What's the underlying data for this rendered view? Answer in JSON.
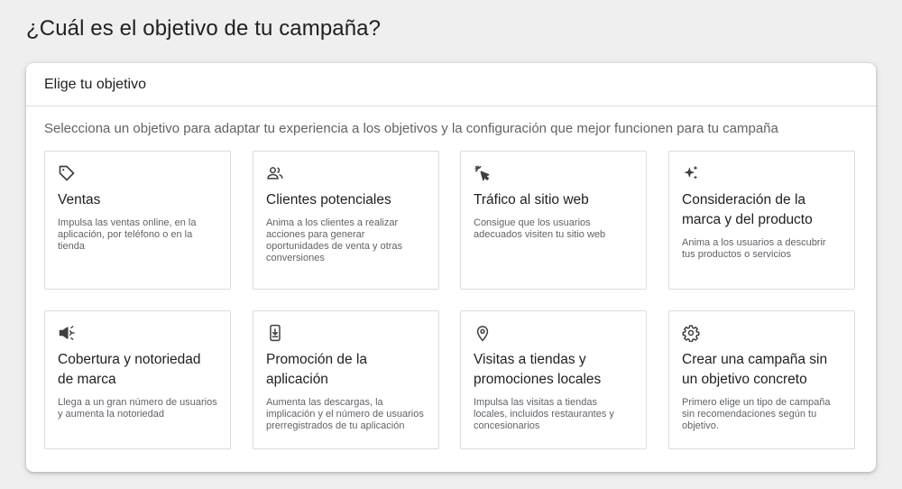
{
  "page": {
    "title": "¿Cuál es el objetivo de tu campaña?"
  },
  "panel": {
    "header": "Elige tu objetivo",
    "description": "Selecciona un objetivo para adaptar tu experiencia a los objetivos y la configuración que mejor funcionen para tu campaña"
  },
  "objectives": [
    {
      "icon": "tag-icon",
      "title": "Ventas",
      "description": "Impulsa las ventas online, en la aplicación, por teléfono o en la tienda"
    },
    {
      "icon": "people-icon",
      "title": "Clientes potenciales",
      "description": "Anima a los clientes a realizar acciones para generar oportunidades de venta y otras conversiones"
    },
    {
      "icon": "cursor-click-icon",
      "title": "Tráfico al sitio web",
      "description": "Consigue que los usuarios adecuados visiten tu sitio web"
    },
    {
      "icon": "sparkle-icon",
      "title": "Consideración de la marca y del producto",
      "description": "Anima a los usuarios a descubrir tus productos o servicios"
    },
    {
      "icon": "megaphone-icon",
      "title": "Cobertura y notoriedad de marca",
      "description": "Llega a un gran número de usuarios y aumenta la notoriedad"
    },
    {
      "icon": "phone-download-icon",
      "title": "Promoción de la aplicación",
      "description": "Aumenta las descargas, la implicación y el número de usuarios prerregistrados de tu aplicación"
    },
    {
      "icon": "location-pin-icon",
      "title": "Visitas a tiendas y promociones locales",
      "description": "Impulsa las visitas a tiendas locales, incluidos restaurantes y concesionarios"
    },
    {
      "icon": "gear-icon",
      "title": "Crear una campaña sin un objetivo concreto",
      "description": "Primero elige un tipo de campaña sin recomendaciones según tu objetivo."
    }
  ]
}
